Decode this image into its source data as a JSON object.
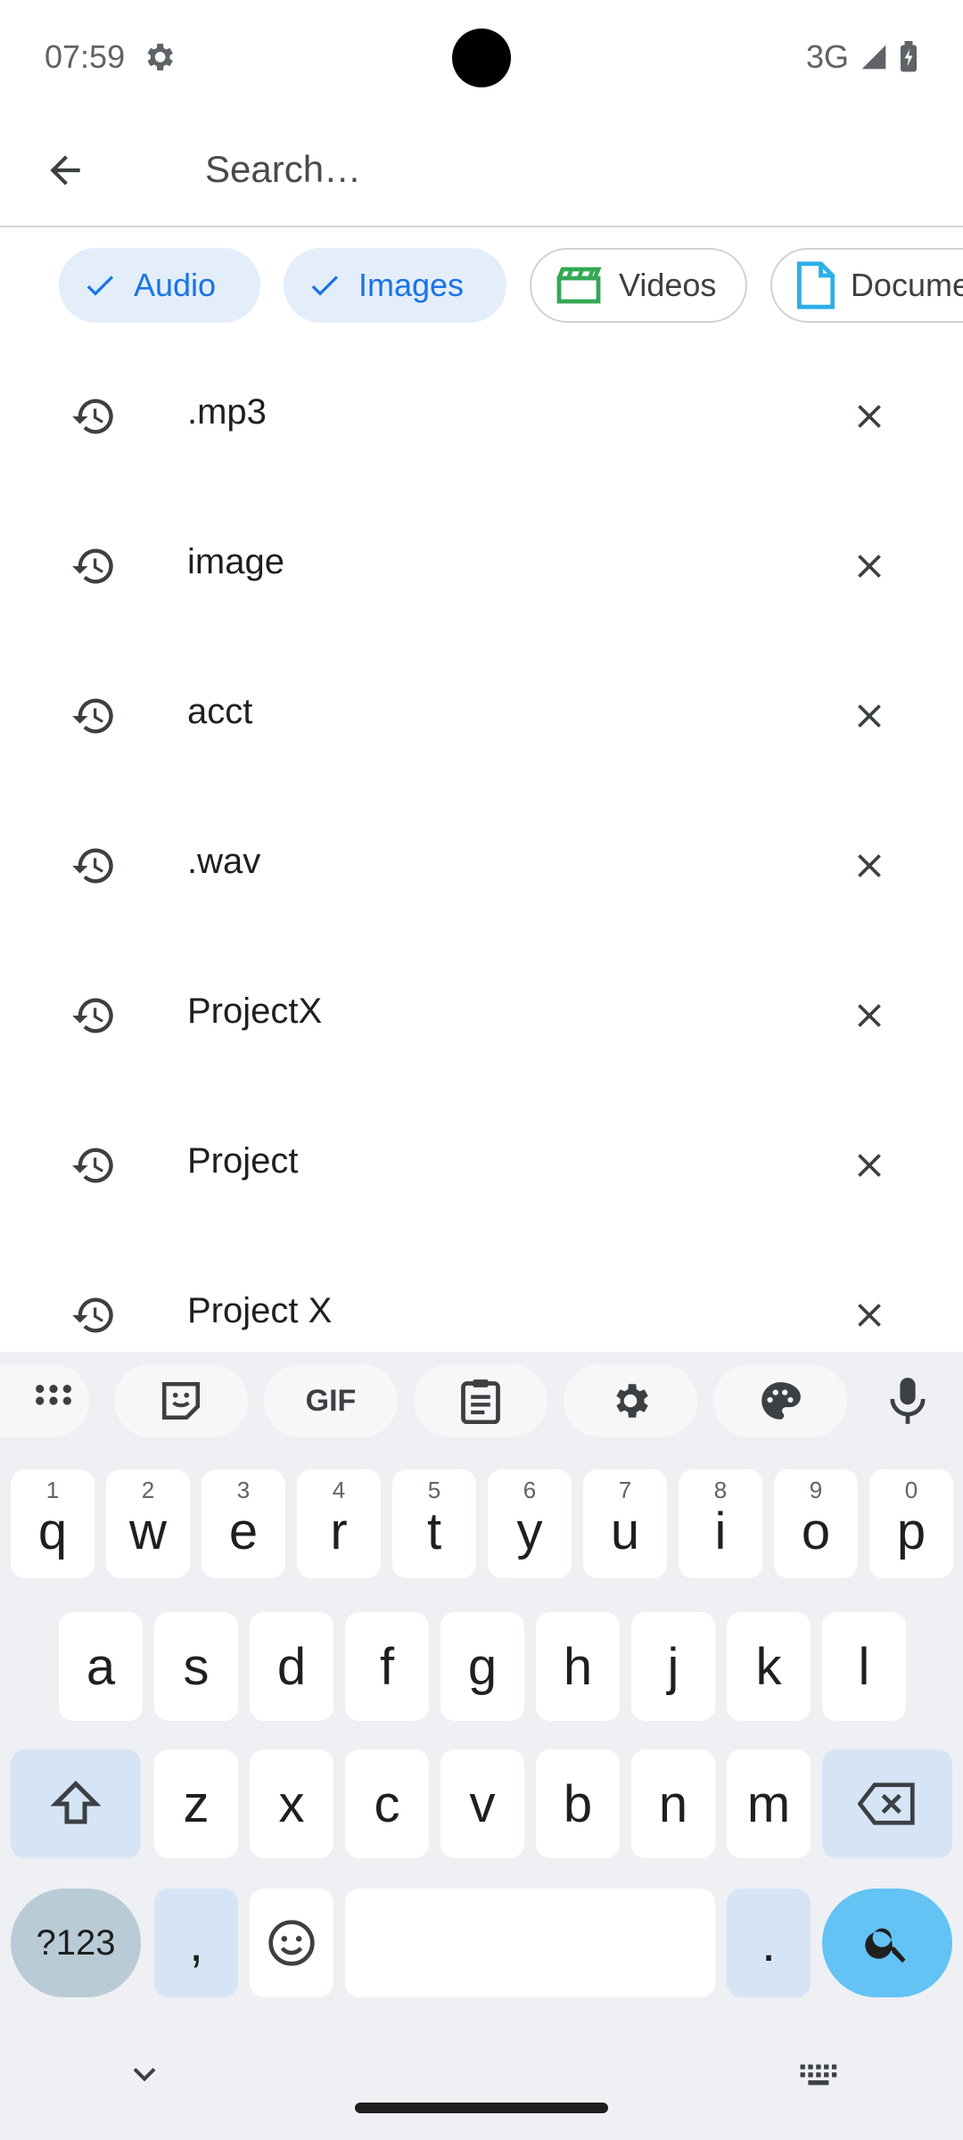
{
  "status_bar": {
    "time": "07:59",
    "network": "3G"
  },
  "search": {
    "placeholder": "Search…",
    "value": ""
  },
  "chips": [
    {
      "label": "Audio",
      "selected": true
    },
    {
      "label": "Images",
      "selected": true
    },
    {
      "label": "Videos",
      "selected": false
    },
    {
      "label": "Documents",
      "selected": false
    }
  ],
  "history": [
    {
      "text": ".mp3"
    },
    {
      "text": "image"
    },
    {
      "text": "acct"
    },
    {
      "text": ".wav"
    },
    {
      "text": "ProjectX"
    },
    {
      "text": "Project"
    },
    {
      "text": "Project X"
    }
  ],
  "keyboard": {
    "toolbar": [
      "apps-grid-icon",
      "sticker-icon",
      "gif",
      "clipboard-icon",
      "settings-icon",
      "palette-icon",
      "mic-icon"
    ],
    "gif_label": "GIF",
    "row1": [
      {
        "letter": "q",
        "hint": "1"
      },
      {
        "letter": "w",
        "hint": "2"
      },
      {
        "letter": "e",
        "hint": "3"
      },
      {
        "letter": "r",
        "hint": "4"
      },
      {
        "letter": "t",
        "hint": "5"
      },
      {
        "letter": "y",
        "hint": "6"
      },
      {
        "letter": "u",
        "hint": "7"
      },
      {
        "letter": "i",
        "hint": "8"
      },
      {
        "letter": "o",
        "hint": "9"
      },
      {
        "letter": "p",
        "hint": "0"
      }
    ],
    "row2": [
      "a",
      "s",
      "d",
      "f",
      "g",
      "h",
      "j",
      "k",
      "l"
    ],
    "row3": [
      "z",
      "x",
      "c",
      "v",
      "b",
      "n",
      "m"
    ],
    "symbols_label": "?123",
    "comma_label": ",",
    "period_label": ".",
    "colors": {
      "enter": "#63c3f4",
      "accent": "#1a73e8"
    }
  }
}
